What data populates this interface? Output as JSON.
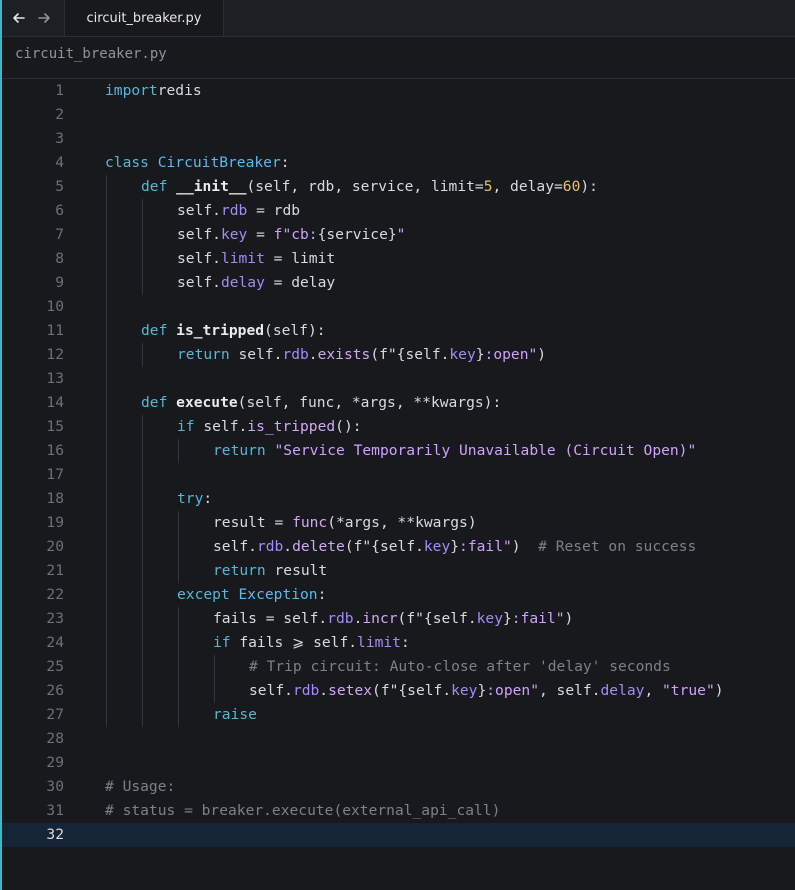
{
  "tab": {
    "title": "circuit_breaker.py"
  },
  "breadcrumb": {
    "path": "circuit_breaker.py"
  },
  "editor": {
    "current_line": 32,
    "lines": [
      {
        "n": "1",
        "code": [
          [
            "kw",
            "import"
          ],
          [
            "",
            "redis"
          ]
        ]
      },
      {
        "n": "2",
        "code": []
      },
      {
        "n": "3",
        "code": []
      },
      {
        "n": "4",
        "code": [
          [
            "kw",
            "class"
          ],
          [
            "",
            " "
          ],
          [
            "cls",
            "CircuitBreaker"
          ],
          [
            "",
            ":"
          ]
        ]
      },
      {
        "n": "5",
        "code": [
          [
            "",
            ""
          ],
          [
            "kw",
            "def"
          ],
          [
            "",
            " "
          ],
          [
            "fn",
            "__init__"
          ],
          [
            "",
            "(self, rdb, service, limit="
          ],
          [
            "num",
            "5"
          ],
          [
            "",
            ", delay="
          ],
          [
            "num",
            "60"
          ],
          [
            "",
            "):"
          ]
        ]
      },
      {
        "n": "6",
        "code": [
          [
            "",
            "self."
          ],
          [
            "attr",
            "rdb"
          ],
          [
            "",
            " = rdb"
          ]
        ]
      },
      {
        "n": "7",
        "code": [
          [
            "",
            "self."
          ],
          [
            "attr",
            "key"
          ],
          [
            "",
            " = "
          ],
          [
            "str",
            "f\"cb:"
          ],
          [
            "",
            "{service}"
          ],
          [
            "str",
            "\""
          ]
        ]
      },
      {
        "n": "8",
        "code": [
          [
            "",
            "self."
          ],
          [
            "attr",
            "limit"
          ],
          [
            "",
            " = limit"
          ]
        ]
      },
      {
        "n": "9",
        "code": [
          [
            "",
            "self."
          ],
          [
            "attr",
            "delay"
          ],
          [
            "",
            " = delay"
          ]
        ]
      },
      {
        "n": "10",
        "code": []
      },
      {
        "n": "11",
        "code": [
          [
            "kw",
            "def"
          ],
          [
            "",
            " "
          ],
          [
            "fn",
            "is_tripped"
          ],
          [
            "",
            "(self):"
          ]
        ]
      },
      {
        "n": "12",
        "code": [
          [
            "kw",
            "return"
          ],
          [
            "",
            " self."
          ],
          [
            "attr",
            "rdb"
          ],
          [
            "",
            "."
          ],
          [
            "call",
            "exists"
          ],
          [
            "",
            "(f\"{self."
          ],
          [
            "attr",
            "key"
          ],
          [
            "",
            "}"
          ],
          [
            "str",
            ":open\""
          ],
          [
            "",
            ")"
          ]
        ]
      },
      {
        "n": "13",
        "code": []
      },
      {
        "n": "14",
        "code": [
          [
            "kw",
            "def"
          ],
          [
            "",
            " "
          ],
          [
            "fn",
            "execute"
          ],
          [
            "",
            "(self, func, *args, **kwargs):"
          ]
        ]
      },
      {
        "n": "15",
        "code": [
          [
            "kw",
            "if"
          ],
          [
            "",
            " self."
          ],
          [
            "call",
            "is_tripped"
          ],
          [
            "",
            "():"
          ]
        ]
      },
      {
        "n": "16",
        "code": [
          [
            "kw",
            "return"
          ],
          [
            "",
            " "
          ],
          [
            "str",
            "\"Service Temporarily Unavailable (Circuit Open)\""
          ]
        ]
      },
      {
        "n": "17",
        "code": []
      },
      {
        "n": "18",
        "code": [
          [
            "kw",
            "try"
          ],
          [
            "",
            ":"
          ]
        ]
      },
      {
        "n": "19",
        "code": [
          [
            "",
            "result = "
          ],
          [
            "call",
            "func"
          ],
          [
            "",
            "(*args, **kwargs)"
          ]
        ]
      },
      {
        "n": "20",
        "code": [
          [
            "",
            "self."
          ],
          [
            "attr",
            "rdb"
          ],
          [
            "",
            "."
          ],
          [
            "call",
            "delete"
          ],
          [
            "",
            "(f\"{self."
          ],
          [
            "attr",
            "key"
          ],
          [
            "",
            "}"
          ],
          [
            "str",
            ":fail\""
          ],
          [
            "",
            ")  "
          ],
          [
            "comment",
            "# Reset on success"
          ]
        ]
      },
      {
        "n": "21",
        "code": [
          [
            "kw",
            "return"
          ],
          [
            "",
            " result"
          ]
        ]
      },
      {
        "n": "22",
        "code": [
          [
            "kw",
            "except"
          ],
          [
            "",
            " "
          ],
          [
            "cls",
            "Exception"
          ],
          [
            "",
            ":"
          ]
        ]
      },
      {
        "n": "23",
        "code": [
          [
            "",
            "fails = self."
          ],
          [
            "attr",
            "rdb"
          ],
          [
            "",
            "."
          ],
          [
            "call",
            "incr"
          ],
          [
            "",
            "(f\"{self."
          ],
          [
            "attr",
            "key"
          ],
          [
            "",
            "}"
          ],
          [
            "str",
            ":fail\""
          ],
          [
            "",
            ")"
          ]
        ]
      },
      {
        "n": "24",
        "code": [
          [
            "kw",
            "if"
          ],
          [
            "",
            " fails ⩾ self."
          ],
          [
            "attr",
            "limit"
          ],
          [
            "",
            ":"
          ]
        ]
      },
      {
        "n": "25",
        "code": [
          [
            "comment",
            "# Trip circuit: Auto-close after 'delay' seconds"
          ]
        ]
      },
      {
        "n": "26",
        "code": [
          [
            "",
            "self."
          ],
          [
            "attr",
            "rdb"
          ],
          [
            "",
            "."
          ],
          [
            "call",
            "setex"
          ],
          [
            "",
            "(f\"{self."
          ],
          [
            "attr",
            "key"
          ],
          [
            "",
            "}"
          ],
          [
            "str",
            ":open\""
          ],
          [
            "",
            ", self."
          ],
          [
            "attr",
            "delay"
          ],
          [
            "",
            ", "
          ],
          [
            "str",
            "\"true\""
          ],
          [
            "",
            ")"
          ]
        ]
      },
      {
        "n": "27",
        "code": [
          [
            "kw",
            "raise"
          ]
        ]
      },
      {
        "n": "28",
        "code": []
      },
      {
        "n": "29",
        "code": []
      },
      {
        "n": "30",
        "code": [
          [
            "comment",
            "# Usage:"
          ]
        ]
      },
      {
        "n": "31",
        "code": [
          [
            "comment",
            "# status = breaker.execute(external_api_call)"
          ]
        ]
      },
      {
        "n": "32",
        "code": []
      }
    ]
  },
  "icons": {
    "back": "arrow-left-icon",
    "forward": "arrow-right-icon"
  },
  "colors": {
    "accent_frame": "#44b4c4",
    "background": "#17191d",
    "current_line": "#152535"
  }
}
